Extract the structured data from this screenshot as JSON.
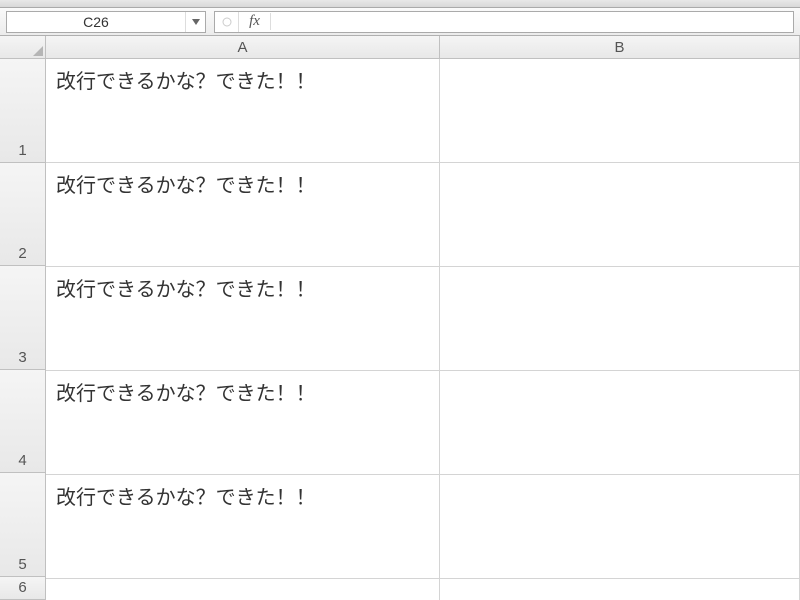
{
  "name_box": {
    "value": "C26"
  },
  "formula_bar": {
    "fx_label": "fx",
    "value": ""
  },
  "columns": [
    {
      "label": "A",
      "key": "A"
    },
    {
      "label": "B",
      "key": "B"
    }
  ],
  "rows": [
    {
      "num": "1",
      "height": "tall",
      "A": "改行できるかな？できた！！",
      "B": ""
    },
    {
      "num": "2",
      "height": "tall",
      "A": "改行できるかな？できた！！",
      "B": ""
    },
    {
      "num": "3",
      "height": "tall",
      "A": "改行できるかな？できた！！",
      "B": ""
    },
    {
      "num": "4",
      "height": "tall",
      "A": "改行できるかな？できた！！",
      "B": ""
    },
    {
      "num": "5",
      "height": "tall",
      "A": "改行できるかな？できた！！",
      "B": ""
    },
    {
      "num": "6",
      "height": "short",
      "A": "",
      "B": ""
    }
  ]
}
